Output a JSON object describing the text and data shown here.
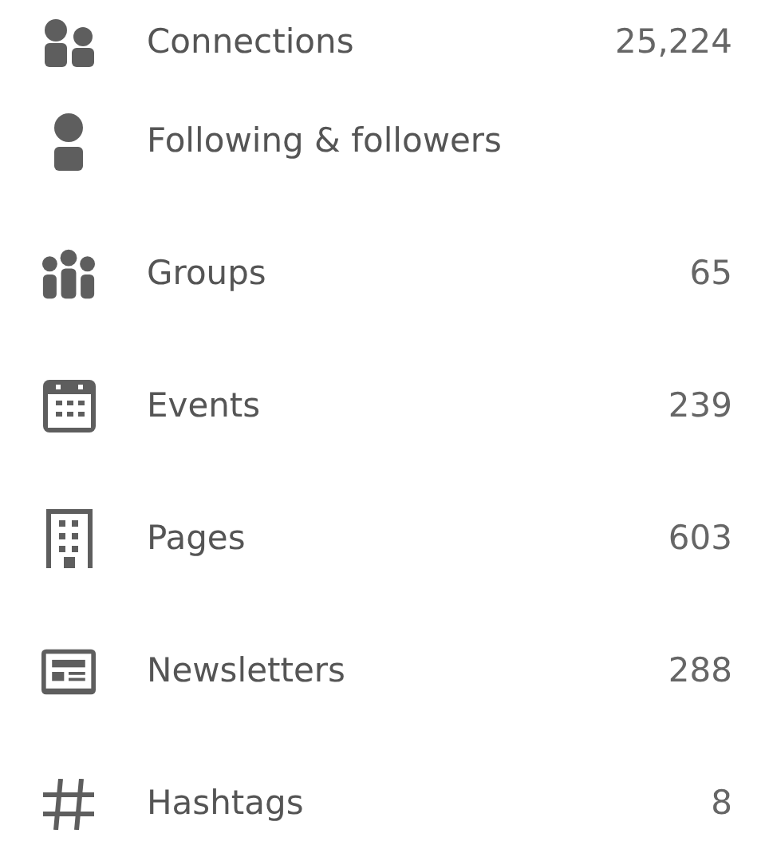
{
  "items": [
    {
      "kind": "people",
      "label": "Connections",
      "count": "25,224"
    },
    {
      "kind": "person",
      "label": "Following & followers"
    },
    {
      "kind": "group",
      "label": "Groups",
      "count": "65"
    },
    {
      "kind": "calendar",
      "label": "Events",
      "count": "239"
    },
    {
      "kind": "building",
      "label": "Pages",
      "count": "603"
    },
    {
      "kind": "newspaper",
      "label": "Newsletters",
      "count": "288"
    },
    {
      "kind": "hashtag",
      "label": "Hashtags",
      "count": "8"
    }
  ]
}
